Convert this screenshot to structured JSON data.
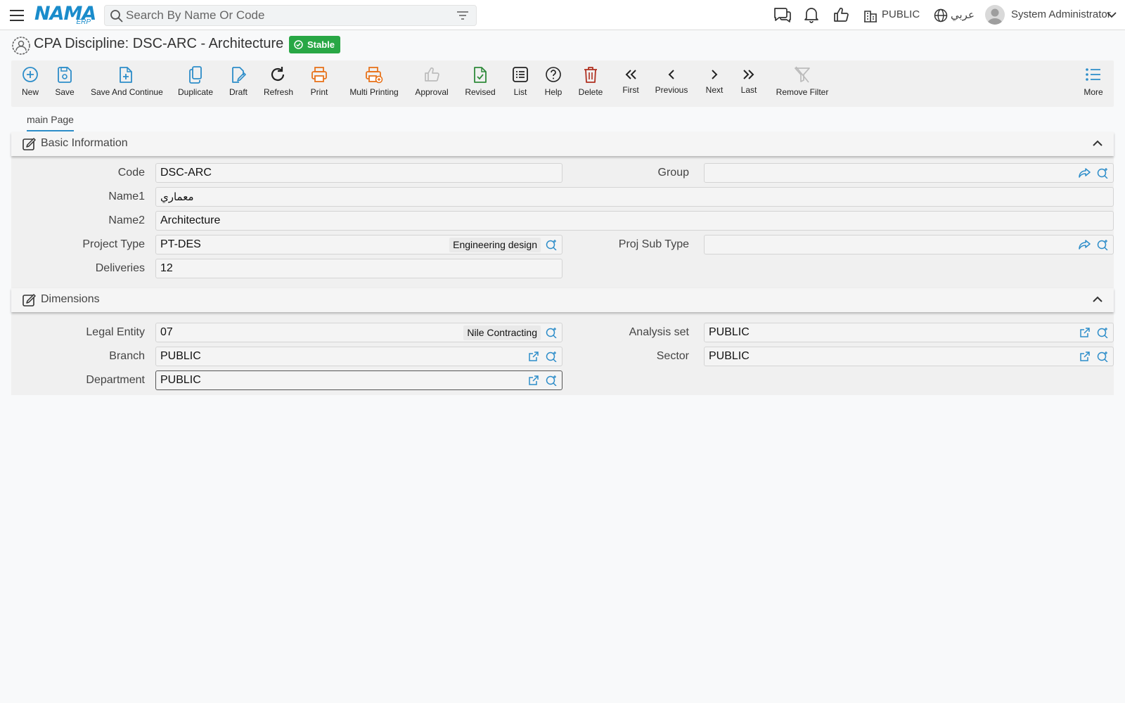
{
  "topbar": {
    "search_placeholder": "Search By Name Or Code",
    "logo_main": "NAMA",
    "logo_sub": "ERP",
    "company": "PUBLIC",
    "language": "عربي",
    "user_name": "System Administrator"
  },
  "page": {
    "title": "CPA Discipline: DSC-ARC - Architecture",
    "status": "Stable"
  },
  "toolbar": {
    "new": "New",
    "save": "Save",
    "save_continue": "Save And Continue",
    "duplicate": "Duplicate",
    "draft": "Draft",
    "refresh": "Refresh",
    "print": "Print",
    "multi_printing": "Multi Printing",
    "approval": "Approval",
    "revised": "Revised",
    "list": "List",
    "help": "Help",
    "delete": "Delete",
    "first": "First",
    "previous": "Previous",
    "next": "Next",
    "last": "Last",
    "remove_filter": "Remove Filter",
    "more": "More"
  },
  "tabs": {
    "main": "main Page"
  },
  "basic": {
    "title": "Basic Information",
    "code_label": "Code",
    "code_value": "DSC-ARC",
    "group_label": "Group",
    "group_value": "",
    "name1_label": "Name1",
    "name1_value": "معماري",
    "name2_label": "Name2",
    "name2_value": "Architecture",
    "project_type_label": "Project Type",
    "project_type_value": "PT-DES",
    "project_type_desc": "Engineering design",
    "proj_sub_type_label": "Proj Sub Type",
    "proj_sub_type_value": "",
    "deliveries_label": "Deliveries",
    "deliveries_value": "12"
  },
  "dimensions": {
    "title": "Dimensions",
    "legal_entity_label": "Legal Entity",
    "legal_entity_value": "07",
    "legal_entity_desc": "Nile Contracting",
    "analysis_set_label": "Analysis set",
    "analysis_set_value": "PUBLIC",
    "branch_label": "Branch",
    "branch_value": "PUBLIC",
    "sector_label": "Sector",
    "sector_value": "PUBLIC",
    "department_label": "Department",
    "department_value": "PUBLIC"
  },
  "colors": {
    "accent": "#2d8dc9",
    "status_green": "#28a745",
    "print_orange": "#e8731c",
    "delete_red": "#b03020"
  }
}
